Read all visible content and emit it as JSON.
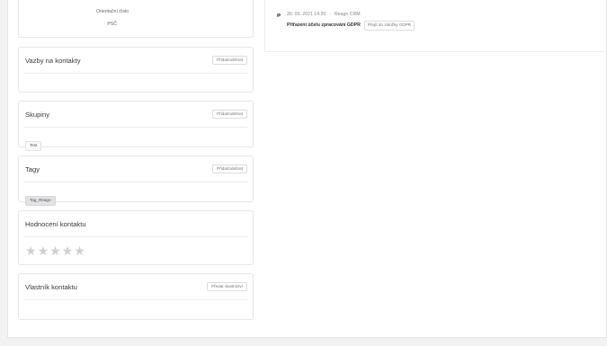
{
  "address": {
    "orientation_label": "Orientační číslo",
    "zip_label": "PSČ"
  },
  "cards": {
    "links": {
      "title": "Vazby na kontakty",
      "button": "Přidat/odebrat"
    },
    "groups": {
      "title": "Skupiny",
      "button": "Přidat/odebrat",
      "items": [
        "Test"
      ]
    },
    "tags": {
      "title": "Tagy",
      "button": "Přidat/odebrat",
      "items": [
        "Tag_Reago"
      ]
    },
    "rating": {
      "title": "Hodnocení kontaktu",
      "stars_total": 5,
      "stars_filled": 0,
      "star_color": "#cfcfd2"
    },
    "owner": {
      "title": "Vlastník kontaktu",
      "button": "Předat vlastnictví"
    }
  },
  "activity": {
    "date": "30. 03. 2021 14:20",
    "separator": "·",
    "source": "Reago CRM",
    "text": "Přiřazení účelu zpracování GDPR",
    "button": "Přejít do záložky GDPR",
    "icon": "fingerprint-icon"
  }
}
